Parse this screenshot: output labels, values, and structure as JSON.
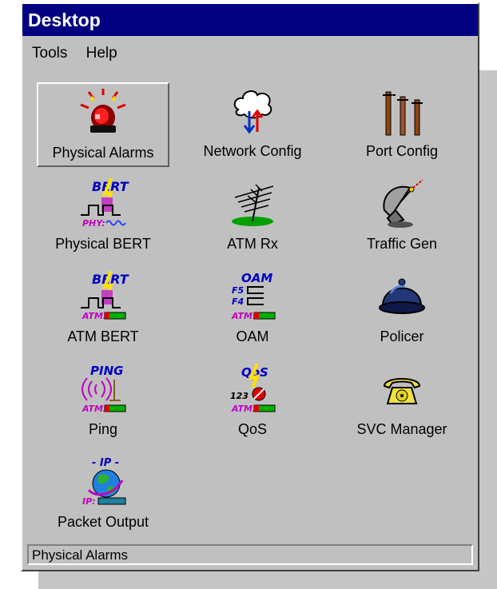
{
  "window": {
    "title": "Desktop"
  },
  "menu": [
    "Tools",
    "Help"
  ],
  "icons": [
    {
      "label": "Physical Alarms",
      "icon": "siren-icon",
      "selected": true
    },
    {
      "label": "Network Config",
      "icon": "network-cloud-icon"
    },
    {
      "label": "Port Config",
      "icon": "ports-icon"
    },
    {
      "label": "Physical BERT",
      "icon": "bert-icon",
      "badge_top": "BERT",
      "badge_bottom": "PHY:"
    },
    {
      "label": "ATM Rx",
      "icon": "antenna-icon"
    },
    {
      "label": "Traffic Gen",
      "icon": "satellite-dish-icon"
    },
    {
      "label": "ATM BERT",
      "icon": "bert-icon",
      "badge_top": "BERT",
      "badge_bottom": "ATM:"
    },
    {
      "label": "OAM",
      "icon": "oam-icon",
      "badge_top": "OAM",
      "f5": "F5",
      "f4": "F4",
      "badge_bottom": "ATM:"
    },
    {
      "label": "Policer",
      "icon": "police-helmet-icon"
    },
    {
      "label": "Ping",
      "icon": "ping-icon",
      "badge_top": "PING",
      "badge_bottom": "ATM:"
    },
    {
      "label": "QoS",
      "icon": "qos-icon",
      "badge_top": "QoS",
      "num": "123",
      "badge_bottom": "ATM:"
    },
    {
      "label": "SVC Manager",
      "icon": "telephone-icon"
    },
    {
      "label": "Packet Output",
      "icon": "globe-ip-icon",
      "badge_top": "- IP -",
      "badge_bottom": "IP:"
    }
  ],
  "status": {
    "text": "Physical Alarms"
  },
  "colors": {
    "title_bar": "#000080",
    "window": "#c0c0c0"
  }
}
